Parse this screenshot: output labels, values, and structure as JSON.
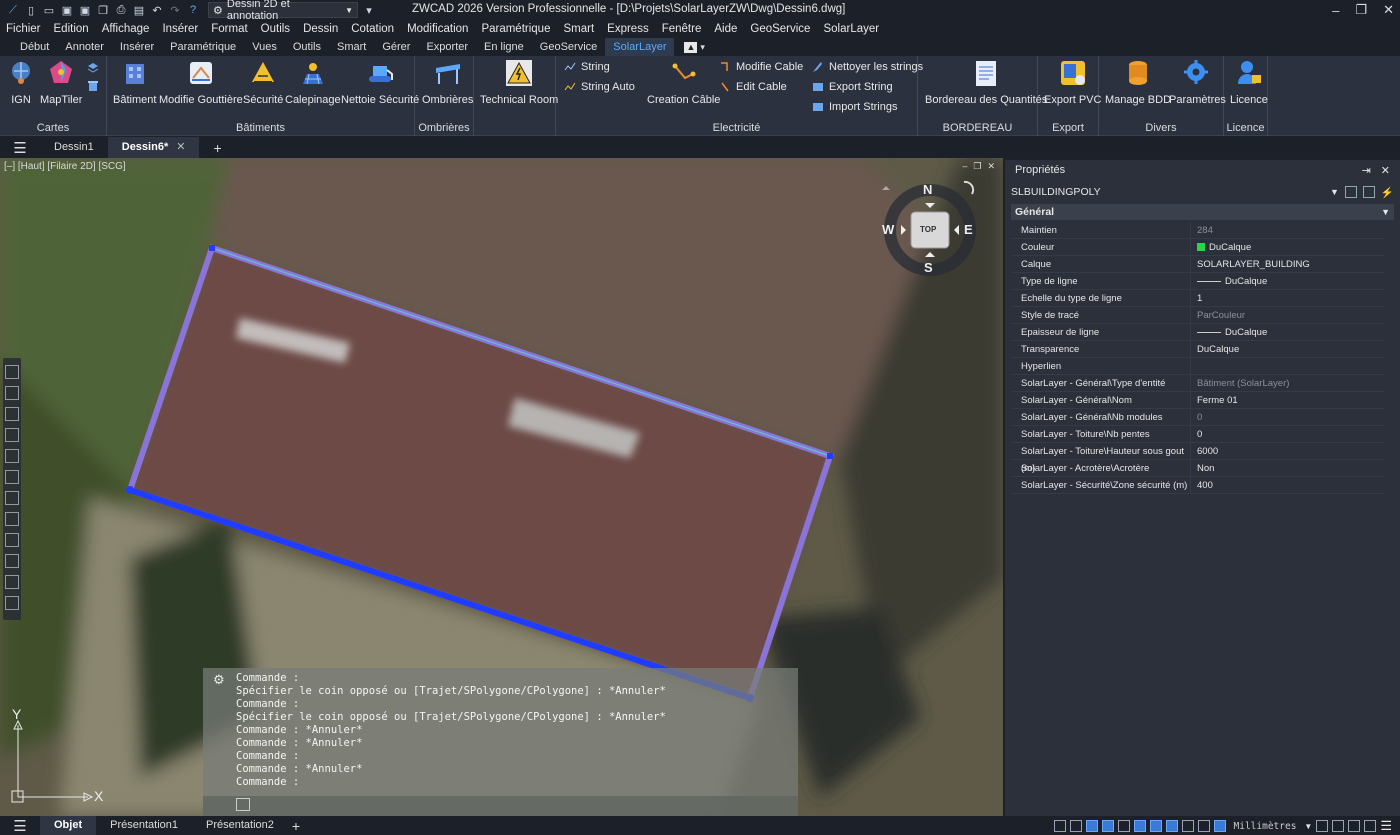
{
  "titlebar": {
    "workspace": "Dessin 2D et annotation",
    "title": "ZWCAD 2026 Version Professionnelle - [D:\\Projets\\SolarLayerZW\\Dwg\\Dessin6.dwg]"
  },
  "menu": [
    "Fichier",
    "Edition",
    "Affichage",
    "Insérer",
    "Format",
    "Outils",
    "Dessin",
    "Cotation",
    "Modification",
    "Paramétrique",
    "Smart",
    "Express",
    "Fenêtre",
    "Aide",
    "GeoService",
    "SolarLayer"
  ],
  "ribbon_tabs": [
    "Début",
    "Annoter",
    "Insérer",
    "Paramétrique",
    "Vues",
    "Outils",
    "Smart",
    "Gérer",
    "Exporter",
    "En ligne",
    "GeoService",
    "SolarLayer"
  ],
  "ribbon_active_tab": "SolarLayer",
  "ribbon": {
    "cartes": {
      "title": "Cartes",
      "ign": "IGN",
      "maptiler": "MapTiler"
    },
    "batiments": {
      "title": "Bâtiments",
      "batiment": "Bâtiment",
      "modifie_gouttiere": "Modifie Gouttière",
      "securite": "Sécurité",
      "calepinage": "Calepinage",
      "nettoie_securite": "Nettoie Sécurité"
    },
    "ombrieres": {
      "title": "Ombrières",
      "ombrieres": "Ombrières"
    },
    "technical": {
      "technical_room": "Technical Room"
    },
    "electricite": {
      "title": "Electricité",
      "string": "String",
      "string_auto": "String Auto",
      "creation_cable": "Creation Câble",
      "modifie_cable": "Modifie Cable",
      "edit_cable": "Edit Cable",
      "nettoyer_strings": "Nettoyer les strings",
      "export_string": "Export String",
      "import_strings": "Import Strings"
    },
    "bordereau": {
      "title": "BORDEREAU",
      "bordereau_quantites": "Bordereau des Quantités"
    },
    "export": {
      "title": "Export",
      "export_pvc": "Export PVC"
    },
    "divers": {
      "title": "Divers",
      "manage_bdd": "Manage BDD",
      "parametres": "Paramètres"
    },
    "licence": {
      "title": "Licence",
      "licence": "Licence"
    }
  },
  "doc_tabs": {
    "tab1": "Dessin1",
    "tab2": "Dessin6*"
  },
  "viewport": {
    "label": "[–] [Haut] [Filaire 2D] [SCG]",
    "compass": {
      "n": "N",
      "s": "S",
      "e": "E",
      "w": "W",
      "top": "TOP"
    },
    "ucs": {
      "x": "X",
      "y": "Y"
    }
  },
  "command_lines": [
    "Commande :",
    "Spécifier le coin opposé ou [Trajet/SPolygone/CPolygone] : *Annuler*",
    "Commande :",
    "Spécifier le coin opposé ou [Trajet/SPolygone/CPolygone] : *Annuler*",
    "Commande : *Annuler*",
    "Commande : *Annuler*",
    "Commande :",
    "Commande : *Annuler*",
    "Commande :"
  ],
  "properties": {
    "title": "Propriétés",
    "selection": "SLBUILDINGPOLY",
    "section": "Général",
    "rows": [
      {
        "k": "Maintien",
        "v": "284",
        "dim": true
      },
      {
        "k": "Couleur",
        "v": "DuCalque",
        "swatch": true
      },
      {
        "k": "Calque",
        "v": "SOLARLAYER_BUILDING"
      },
      {
        "k": "Type de ligne",
        "v": "DuCalque",
        "line": true
      },
      {
        "k": "Echelle du type de ligne",
        "v": "1"
      },
      {
        "k": "Style de tracé",
        "v": "ParCouleur",
        "dim": true
      },
      {
        "k": "Epaisseur de ligne",
        "v": "DuCalque",
        "line": true
      },
      {
        "k": "Transparence",
        "v": "DuCalque"
      },
      {
        "k": "Hyperlien",
        "v": ""
      },
      {
        "k": "SolarLayer - Général\\Type d'entité",
        "v": "Bâtiment (SolarLayer)",
        "dim": true
      },
      {
        "k": "SolarLayer - Général\\Nom",
        "v": "Ferme 01"
      },
      {
        "k": "SolarLayer - Général\\Nb modules",
        "v": "0",
        "dim": true
      },
      {
        "k": "SolarLayer - Toiture\\Nb pentes",
        "v": "0"
      },
      {
        "k": "SolarLayer - Toiture\\Hauteur sous gout (m)",
        "v": "6000"
      },
      {
        "k": "SolarLayer - Acrotère\\Acrotère",
        "v": "Non"
      },
      {
        "k": "SolarLayer - Sécurité\\Zone sécurité (m)",
        "v": "400"
      }
    ]
  },
  "status": {
    "tab_model": "Objet",
    "tab_p1": "Présentation1",
    "tab_p2": "Présentation2",
    "units": "Millimètres"
  },
  "colors": {
    "accent": "#3a9bff",
    "polygon": "#7f6ee0",
    "selected_edge": "#1f3cff",
    "swatch": "#22d84a"
  }
}
